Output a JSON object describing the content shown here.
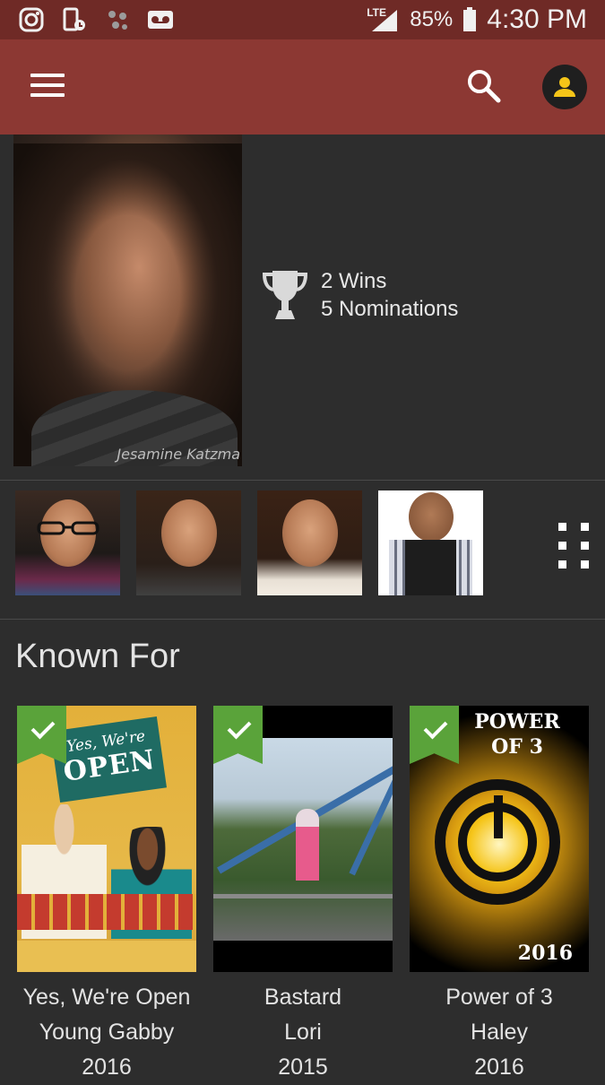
{
  "status_bar": {
    "network": "LTE",
    "battery": "85%",
    "time": "4:30 PM",
    "icons": [
      "instagram-icon",
      "phone-clock-icon",
      "dots-icon",
      "voicemail-icon",
      "signal-icon",
      "battery-icon"
    ]
  },
  "app_bar": {
    "icons": [
      "menu-icon",
      "search-icon",
      "account-icon"
    ],
    "colors": {
      "status": "#6f2a26",
      "toolbar": "#8c3833",
      "avatar_fg": "#f5c518"
    }
  },
  "profile": {
    "photo_watermark": "Jesamine Katzma",
    "awards": {
      "wins": "2 Wins",
      "nominations": "5 Nominations"
    }
  },
  "photos": {
    "count_shown": 4,
    "more_icon": "grid-icon"
  },
  "known_for": {
    "title": "Known For",
    "items": [
      {
        "title": "Yes, We're Open",
        "role": "Young Gabby",
        "year": "2016",
        "poster": {
          "line1": "Yes, We're",
          "line2": "OPEN"
        }
      },
      {
        "title": "Bastard",
        "role": "Lori",
        "year": "2015"
      },
      {
        "title": "Power of 3",
        "role": "Haley",
        "year": "2016",
        "poster": {
          "title": "POWER OF 3",
          "year": "2016"
        }
      }
    ]
  }
}
